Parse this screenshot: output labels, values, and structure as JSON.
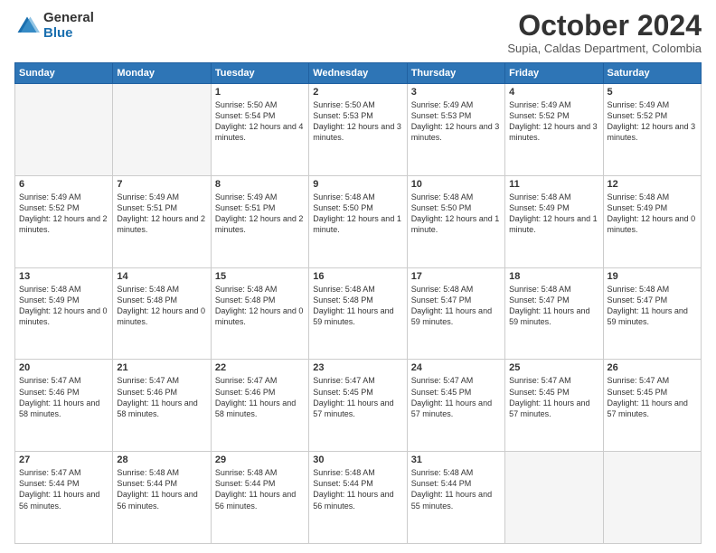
{
  "logo": {
    "general": "General",
    "blue": "Blue"
  },
  "header": {
    "month": "October 2024",
    "location": "Supia, Caldas Department, Colombia"
  },
  "weekdays": [
    "Sunday",
    "Monday",
    "Tuesday",
    "Wednesday",
    "Thursday",
    "Friday",
    "Saturday"
  ],
  "weeks": [
    [
      {
        "day": "",
        "info": ""
      },
      {
        "day": "",
        "info": ""
      },
      {
        "day": "1",
        "info": "Sunrise: 5:50 AM\nSunset: 5:54 PM\nDaylight: 12 hours and 4 minutes."
      },
      {
        "day": "2",
        "info": "Sunrise: 5:50 AM\nSunset: 5:53 PM\nDaylight: 12 hours and 3 minutes."
      },
      {
        "day": "3",
        "info": "Sunrise: 5:49 AM\nSunset: 5:53 PM\nDaylight: 12 hours and 3 minutes."
      },
      {
        "day": "4",
        "info": "Sunrise: 5:49 AM\nSunset: 5:52 PM\nDaylight: 12 hours and 3 minutes."
      },
      {
        "day": "5",
        "info": "Sunrise: 5:49 AM\nSunset: 5:52 PM\nDaylight: 12 hours and 3 minutes."
      }
    ],
    [
      {
        "day": "6",
        "info": "Sunrise: 5:49 AM\nSunset: 5:52 PM\nDaylight: 12 hours and 2 minutes."
      },
      {
        "day": "7",
        "info": "Sunrise: 5:49 AM\nSunset: 5:51 PM\nDaylight: 12 hours and 2 minutes."
      },
      {
        "day": "8",
        "info": "Sunrise: 5:49 AM\nSunset: 5:51 PM\nDaylight: 12 hours and 2 minutes."
      },
      {
        "day": "9",
        "info": "Sunrise: 5:48 AM\nSunset: 5:50 PM\nDaylight: 12 hours and 1 minute."
      },
      {
        "day": "10",
        "info": "Sunrise: 5:48 AM\nSunset: 5:50 PM\nDaylight: 12 hours and 1 minute."
      },
      {
        "day": "11",
        "info": "Sunrise: 5:48 AM\nSunset: 5:49 PM\nDaylight: 12 hours and 1 minute."
      },
      {
        "day": "12",
        "info": "Sunrise: 5:48 AM\nSunset: 5:49 PM\nDaylight: 12 hours and 0 minutes."
      }
    ],
    [
      {
        "day": "13",
        "info": "Sunrise: 5:48 AM\nSunset: 5:49 PM\nDaylight: 12 hours and 0 minutes."
      },
      {
        "day": "14",
        "info": "Sunrise: 5:48 AM\nSunset: 5:48 PM\nDaylight: 12 hours and 0 minutes."
      },
      {
        "day": "15",
        "info": "Sunrise: 5:48 AM\nSunset: 5:48 PM\nDaylight: 12 hours and 0 minutes."
      },
      {
        "day": "16",
        "info": "Sunrise: 5:48 AM\nSunset: 5:48 PM\nDaylight: 11 hours and 59 minutes."
      },
      {
        "day": "17",
        "info": "Sunrise: 5:48 AM\nSunset: 5:47 PM\nDaylight: 11 hours and 59 minutes."
      },
      {
        "day": "18",
        "info": "Sunrise: 5:48 AM\nSunset: 5:47 PM\nDaylight: 11 hours and 59 minutes."
      },
      {
        "day": "19",
        "info": "Sunrise: 5:48 AM\nSunset: 5:47 PM\nDaylight: 11 hours and 59 minutes."
      }
    ],
    [
      {
        "day": "20",
        "info": "Sunrise: 5:47 AM\nSunset: 5:46 PM\nDaylight: 11 hours and 58 minutes."
      },
      {
        "day": "21",
        "info": "Sunrise: 5:47 AM\nSunset: 5:46 PM\nDaylight: 11 hours and 58 minutes."
      },
      {
        "day": "22",
        "info": "Sunrise: 5:47 AM\nSunset: 5:46 PM\nDaylight: 11 hours and 58 minutes."
      },
      {
        "day": "23",
        "info": "Sunrise: 5:47 AM\nSunset: 5:45 PM\nDaylight: 11 hours and 57 minutes."
      },
      {
        "day": "24",
        "info": "Sunrise: 5:47 AM\nSunset: 5:45 PM\nDaylight: 11 hours and 57 minutes."
      },
      {
        "day": "25",
        "info": "Sunrise: 5:47 AM\nSunset: 5:45 PM\nDaylight: 11 hours and 57 minutes."
      },
      {
        "day": "26",
        "info": "Sunrise: 5:47 AM\nSunset: 5:45 PM\nDaylight: 11 hours and 57 minutes."
      }
    ],
    [
      {
        "day": "27",
        "info": "Sunrise: 5:47 AM\nSunset: 5:44 PM\nDaylight: 11 hours and 56 minutes."
      },
      {
        "day": "28",
        "info": "Sunrise: 5:48 AM\nSunset: 5:44 PM\nDaylight: 11 hours and 56 minutes."
      },
      {
        "day": "29",
        "info": "Sunrise: 5:48 AM\nSunset: 5:44 PM\nDaylight: 11 hours and 56 minutes."
      },
      {
        "day": "30",
        "info": "Sunrise: 5:48 AM\nSunset: 5:44 PM\nDaylight: 11 hours and 56 minutes."
      },
      {
        "day": "31",
        "info": "Sunrise: 5:48 AM\nSunset: 5:44 PM\nDaylight: 11 hours and 55 minutes."
      },
      {
        "day": "",
        "info": ""
      },
      {
        "day": "",
        "info": ""
      }
    ]
  ]
}
